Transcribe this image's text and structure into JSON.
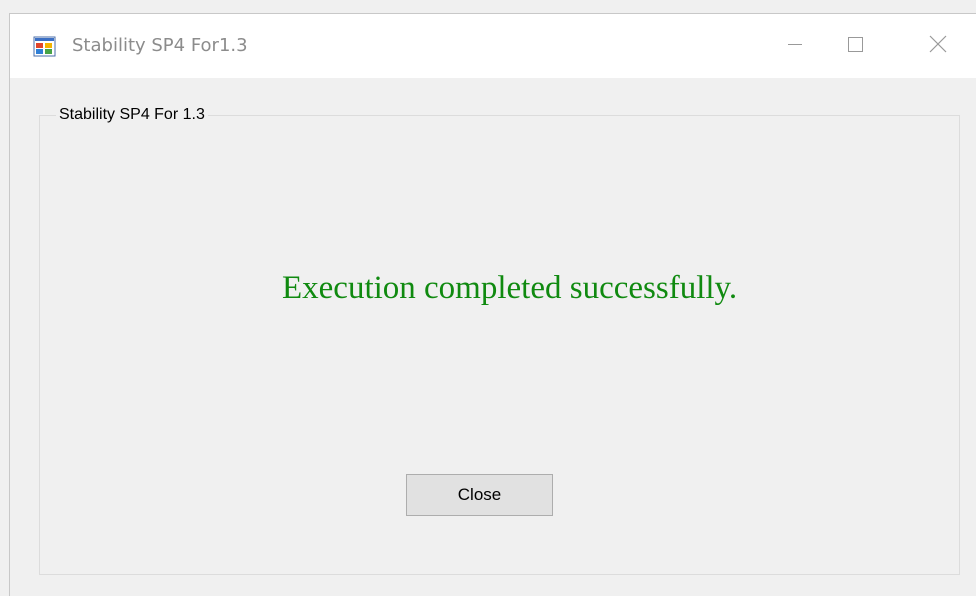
{
  "window": {
    "title": "Stability SP4 For1.3",
    "controls": {
      "minimize_icon": "minimize-icon",
      "maximize_icon": "maximize-icon",
      "close_icon": "close-icon"
    }
  },
  "groupbox": {
    "label": "Stability SP4 For 1.3"
  },
  "message": {
    "text": "Execution completed successfully.",
    "color": "#108a10"
  },
  "buttons": {
    "close_label": "Close"
  }
}
